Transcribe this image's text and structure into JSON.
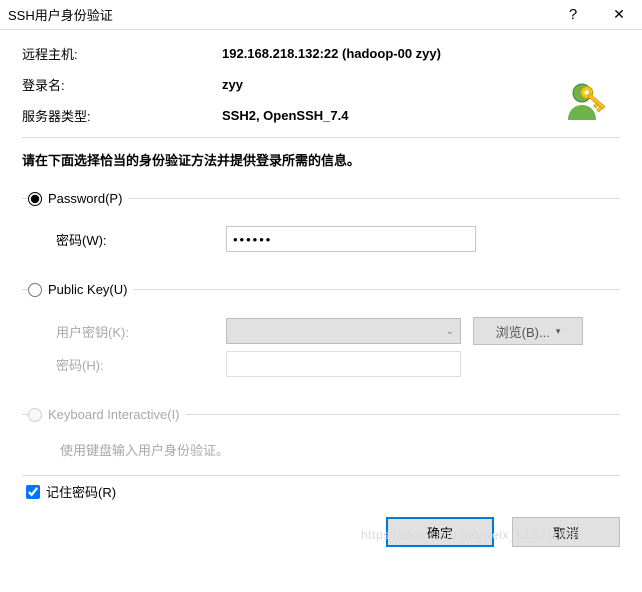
{
  "titlebar": {
    "title": "SSH用户身份验证"
  },
  "info": {
    "host_label": "远程主机:",
    "host_value": "192.168.218.132:22 (hadoop-00 zyy)",
    "login_label": "登录名:",
    "login_value": "zyy",
    "server_label": "服务器类型:",
    "server_value": "SSH2, OpenSSH_7.4"
  },
  "instruction": "请在下面选择恰当的身份验证方法并提供登录所需的信息。",
  "password_group": {
    "legend": "Password(P)",
    "pwd_label": "密码(W):",
    "pwd_value": "••••••"
  },
  "pubkey_group": {
    "legend": "Public Key(U)",
    "key_label": "用户密钥(K):",
    "browse_label": "浏览(B)...",
    "pwd_label": "密码(H):"
  },
  "kb_group": {
    "legend": "Keyboard Interactive(I)",
    "desc": "使用键盘输入用户身份验证。"
  },
  "remember": {
    "label": "记住密码(R)"
  },
  "footer": {
    "ok": "确定",
    "cancel": "取消"
  },
  "watermark": "https://blog.csdn.net/weix_51CTO博客",
  "icon": {
    "name": "user-key-icon"
  }
}
